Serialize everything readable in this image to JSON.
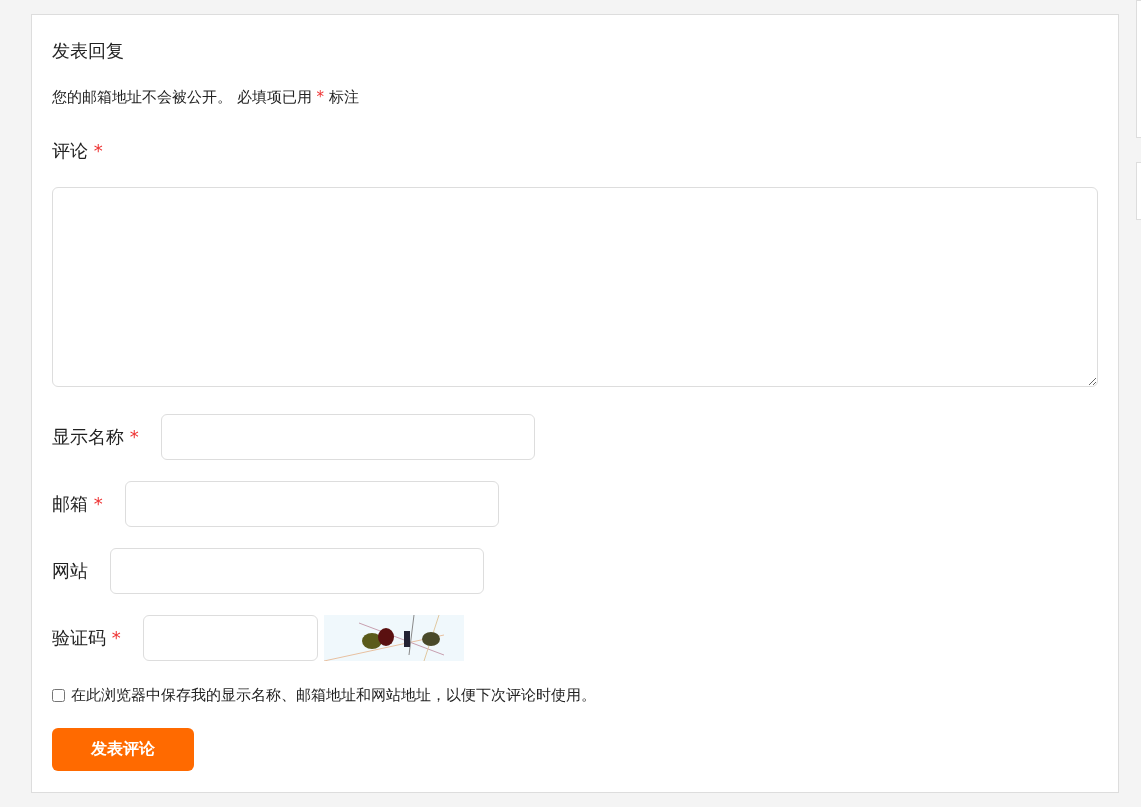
{
  "title": "发表回复",
  "notes": {
    "before": "您的邮箱地址不会被公开。 必填项已用",
    "mark": "*",
    "after": "标注"
  },
  "comment": {
    "label": "评论",
    "required_mark": "*"
  },
  "fields": [
    {
      "label": "显示名称",
      "required_mark": "*"
    },
    {
      "label": "邮箱",
      "required_mark": "*"
    },
    {
      "label": "网站"
    },
    {
      "label": "验证码",
      "required_mark": "*",
      "kind": "captcha"
    }
  ],
  "remember": {
    "label": "在此浏览器中保存我的显示名称、邮箱地址和网站地址，以便下次评论时使用。",
    "checked": false
  },
  "submit": "发表评论"
}
